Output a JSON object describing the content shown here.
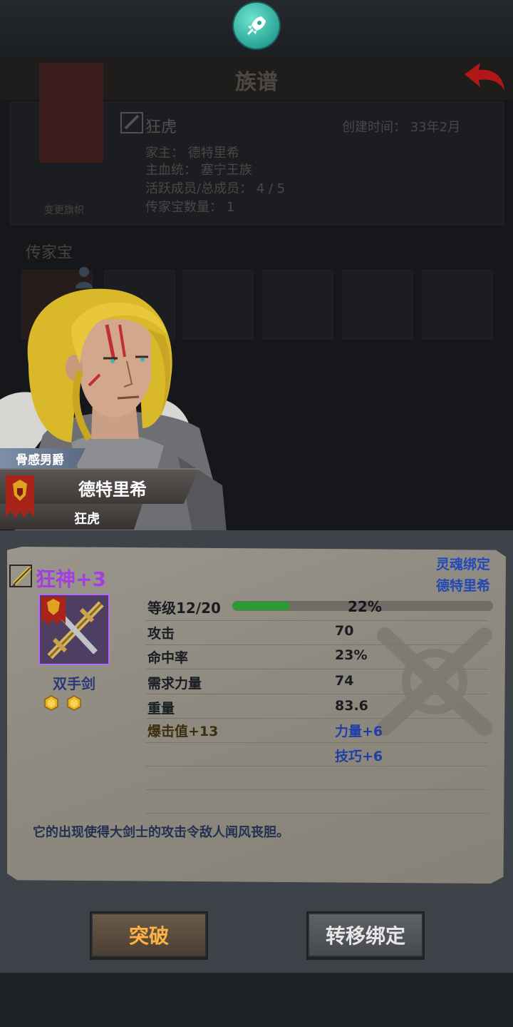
{
  "genealogy": {
    "title": "族谱",
    "clan_name": "狂虎",
    "created": "创建时间： 33年2月",
    "patriarch": "家主： 德特里希",
    "bloodline": "主血统： 塞宁王族",
    "members": "活跃成员/总成员： 4 / 5",
    "heirloom_count": "传家宝数量： 1",
    "banner_label": "变更旗帜",
    "heirloom_section": "传家宝"
  },
  "character": {
    "title": "骨感男爵",
    "name": "德特里希",
    "clan": "狂虎"
  },
  "item": {
    "name": "狂神+3",
    "type": "双手剑",
    "soul_bind": "灵魂绑定",
    "bound_to": "德特里希",
    "level_label": "等级12/20",
    "level_percent": "22%",
    "level_fraction": 0.22,
    "stats": [
      {
        "label": "攻击",
        "value": "70"
      },
      {
        "label": "命中率",
        "value": "23%"
      },
      {
        "label": "需求力量",
        "value": "74"
      },
      {
        "label": "重量",
        "value": "83.6"
      }
    ],
    "bonuses": [
      {
        "label": "爆击值+13",
        "value": "力量+6"
      },
      {
        "label": "",
        "value": "技巧+6"
      }
    ],
    "description": "它的出现使得大剑士的攻击令敌人闻风丧胆。",
    "gem_count": 2
  },
  "buttons": {
    "breakthrough": "突破",
    "transfer_bind": "转移绑定"
  },
  "colors": {
    "rarity_purple": "#a33fe0",
    "bind_blue": "#2348b8",
    "exp_green": "#2e9a34",
    "breakthrough_text": "#ffb244"
  }
}
